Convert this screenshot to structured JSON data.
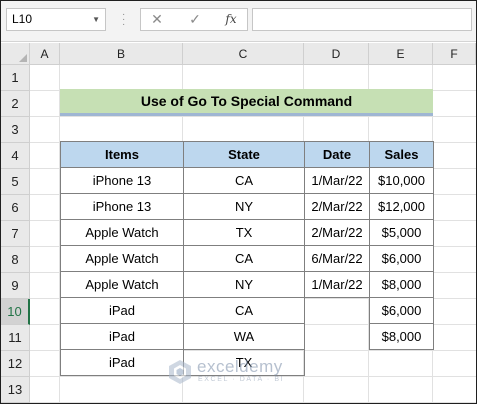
{
  "formula_bar": {
    "name_box": "L10",
    "cancel_icon": "✕",
    "enter_icon": "✓",
    "fx_label": "fx",
    "formula_value": ""
  },
  "columns": [
    "A",
    "B",
    "C",
    "D",
    "E",
    "F"
  ],
  "rows": [
    "1",
    "2",
    "3",
    "4",
    "5",
    "6",
    "7",
    "8",
    "9",
    "10",
    "11",
    "12",
    "13"
  ],
  "selected_row": "10",
  "title": "Use of Go To Special Command",
  "table": {
    "headers": [
      "Items",
      "State",
      "Date",
      "Sales"
    ],
    "rows": [
      {
        "item": "iPhone 13",
        "state": "CA",
        "date": "1/Mar/22",
        "sales": "$10,000"
      },
      {
        "item": "iPhone 13",
        "state": "NY",
        "date": "2/Mar/22",
        "sales": "$12,000"
      },
      {
        "item": "Apple Watch",
        "state": "TX",
        "date": "2/Mar/22",
        "sales": "$5,000"
      },
      {
        "item": "Apple Watch",
        "state": "CA",
        "date": "6/Mar/22",
        "sales": "$6,000"
      },
      {
        "item": "Apple Watch",
        "state": "NY",
        "date": "1/Mar/22",
        "sales": "$8,000"
      },
      {
        "item": "iPad",
        "state": "CA",
        "date": "",
        "sales": "$6,000"
      },
      {
        "item": "iPad",
        "state": "WA",
        "date": "",
        "sales": "$8,000"
      },
      {
        "item": "iPad",
        "state": "TX",
        "date": "",
        "sales": ""
      }
    ]
  },
  "watermark": {
    "name": "exceldemy",
    "tagline": "EXCEL · DATA · BI"
  },
  "colors": {
    "title_fill": "#c6e0b4",
    "header_fill": "#bdd7ee",
    "selected_row_accent": "#217346"
  }
}
